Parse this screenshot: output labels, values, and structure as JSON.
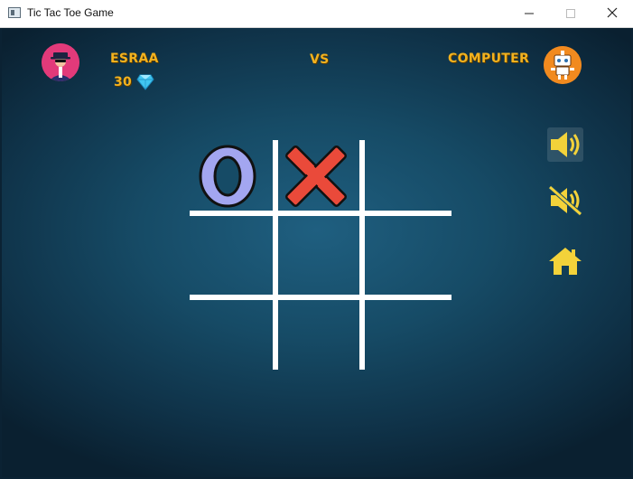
{
  "window": {
    "title": "Tic Tac Toe Game",
    "icon": "app-window-icon"
  },
  "header": {
    "player_name": "ESRAA",
    "vs_label": "VS",
    "computer_name": "COMPUTER",
    "score": "30",
    "score_icon": "diamond-icon",
    "player_avatar": "player-avatar",
    "computer_avatar": "robot-avatar"
  },
  "board": {
    "cells": [
      "O",
      "X",
      "",
      "",
      "",
      "",
      "",
      "",
      ""
    ]
  },
  "controls": {
    "sound_on_icon": "speaker-on-icon",
    "sound_off_icon": "speaker-mute-icon",
    "home_icon": "home-icon"
  },
  "colors": {
    "accent": "#f3b21e",
    "o_mark": "#a3a6f0",
    "x_mark": "#ea4a3a",
    "grid": "#ffffff",
    "background": "#164b66"
  }
}
